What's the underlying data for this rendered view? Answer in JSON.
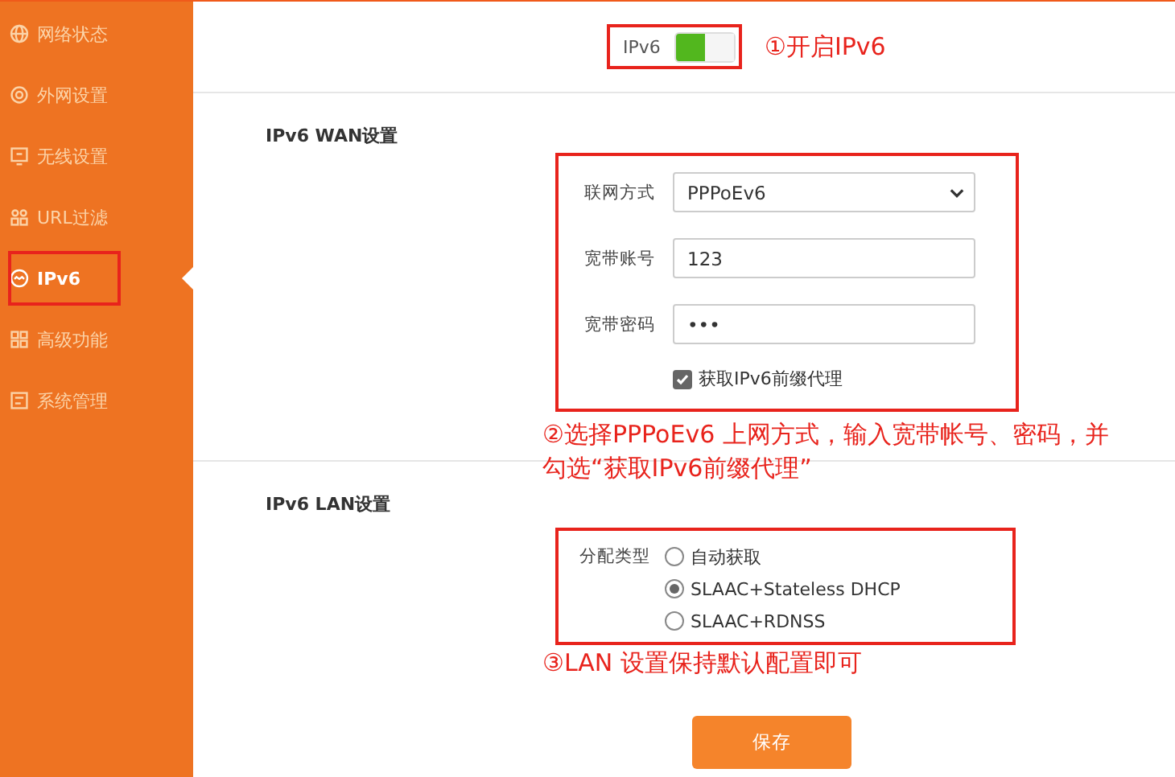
{
  "sidebar": {
    "items": [
      {
        "label": "网络状态",
        "selected": false
      },
      {
        "label": "外网设置",
        "selected": false
      },
      {
        "label": "无线设置",
        "selected": false
      },
      {
        "label": "URL过滤",
        "selected": false
      },
      {
        "label": "IPv6",
        "selected": true
      },
      {
        "label": "高级功能",
        "selected": false
      },
      {
        "label": "系统管理",
        "selected": false
      }
    ]
  },
  "ipv6_toggle": {
    "label": "IPv6",
    "on": true
  },
  "wan": {
    "title": "IPv6 WAN设置",
    "fields": [
      {
        "kind": "select",
        "label": "联网方式",
        "value": "PPPoEv6"
      },
      {
        "kind": "text",
        "label": "宽带账号",
        "value": "123"
      },
      {
        "kind": "password",
        "label": "宽带密码",
        "value": "•••"
      }
    ],
    "prefix_proxy": {
      "label": "获取IPv6前缀代理",
      "checked": true
    }
  },
  "lan": {
    "title": "IPv6 LAN设置",
    "label": "分配类型",
    "options": [
      {
        "label": "自动获取",
        "selected": false
      },
      {
        "label": "SLAAC+Stateless DHCP",
        "selected": true
      },
      {
        "label": "SLAAC+RDNSS",
        "selected": false
      }
    ]
  },
  "save_button": "保存",
  "annotations": [
    "①开启IPv6",
    "②选择PPPoEv6 上网方式，输入宽带帐号、密码，并勾选“获取IPv6前缀代理”",
    "③LAN 设置保持默认配置即可"
  ]
}
